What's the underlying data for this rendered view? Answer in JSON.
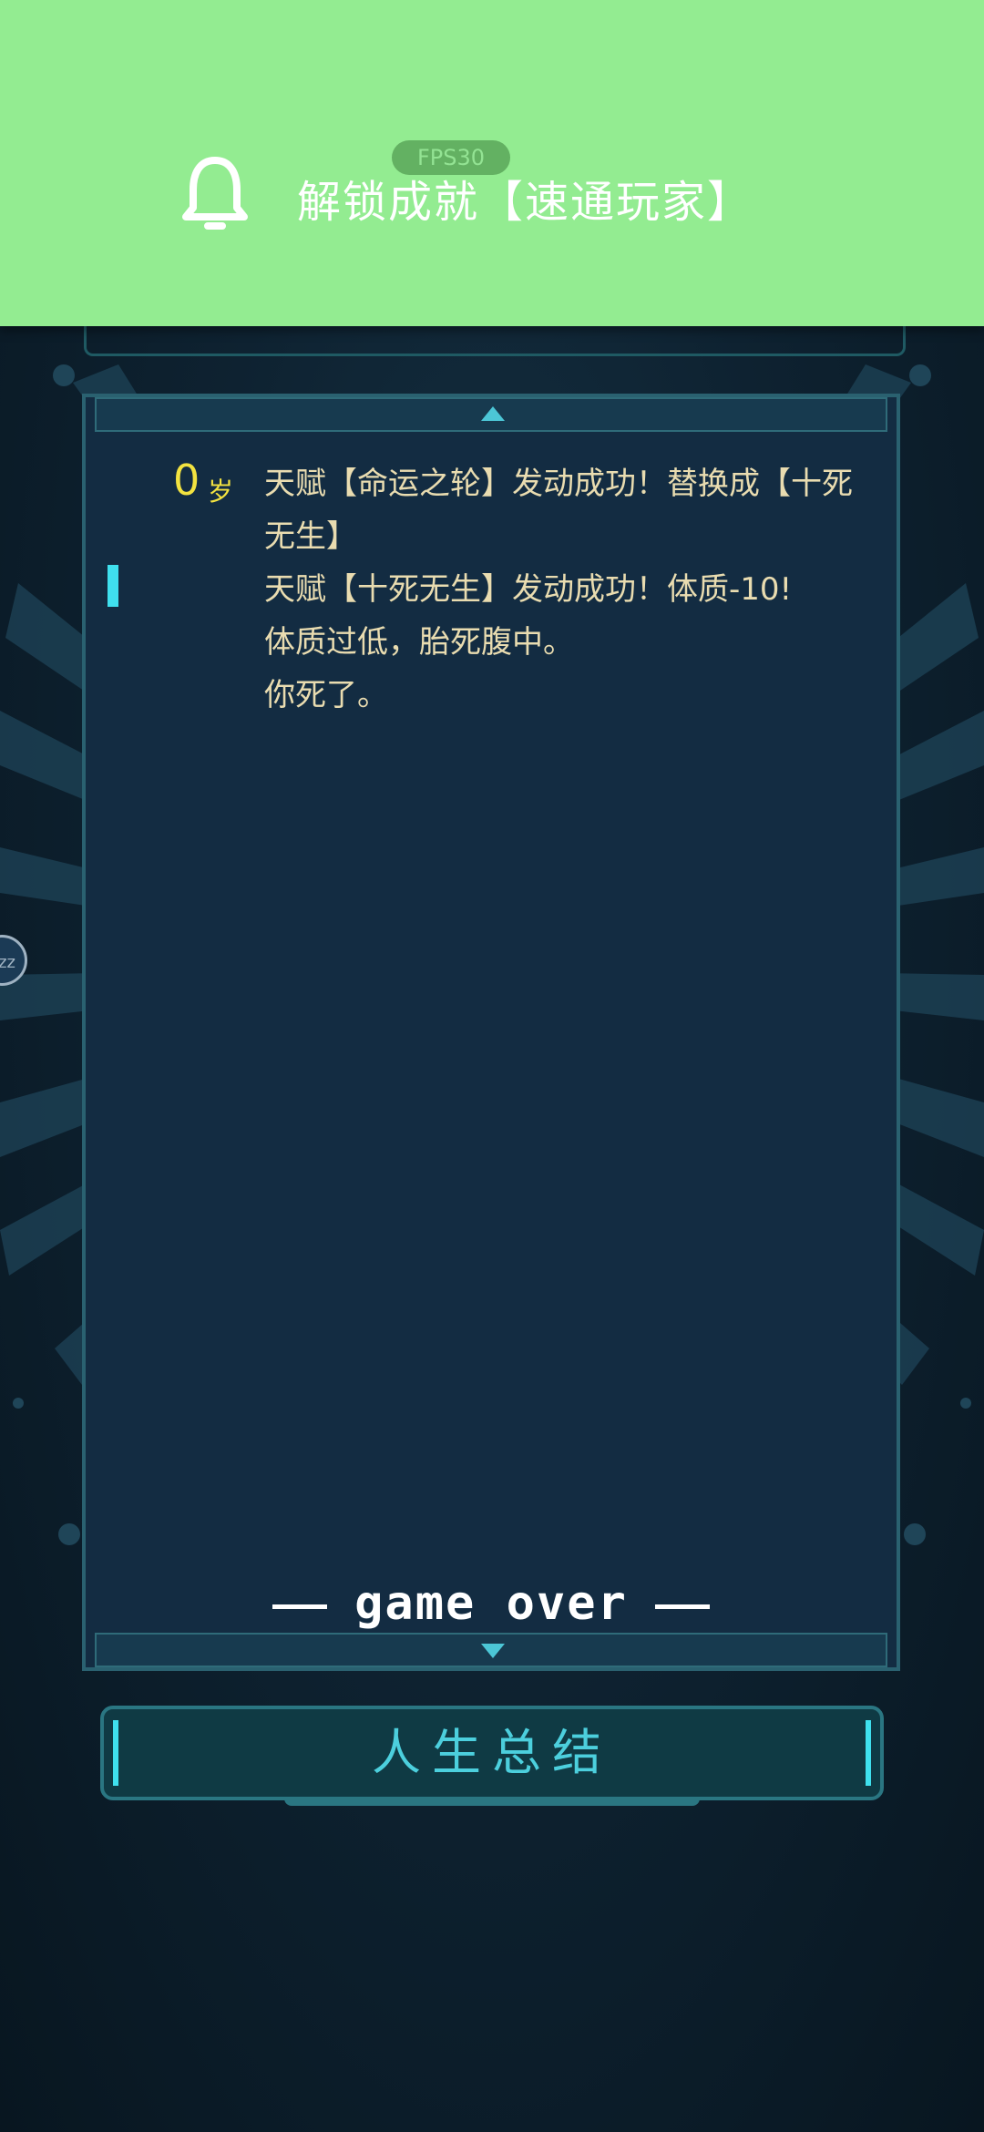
{
  "notification": {
    "text": "解锁成就【速通玩家】",
    "icon": "bell-icon",
    "fps_label": "FPS30"
  },
  "log": {
    "age": "0",
    "age_unit": "岁",
    "lines": [
      "天赋【命运之轮】发动成功！替换成【十死无生】",
      "天赋【十死无生】发动成功！体质-10!",
      "体质过低，胎死腹中。",
      "你死了。"
    ],
    "game_over": "game over"
  },
  "actions": {
    "summary_label": "人生总结"
  },
  "float_widget": {
    "label": "zz"
  },
  "colors": {
    "banner": "#93ec91",
    "accent": "#3fe0ee",
    "age": "#f3e340",
    "log_text": "#e9dcb0"
  }
}
